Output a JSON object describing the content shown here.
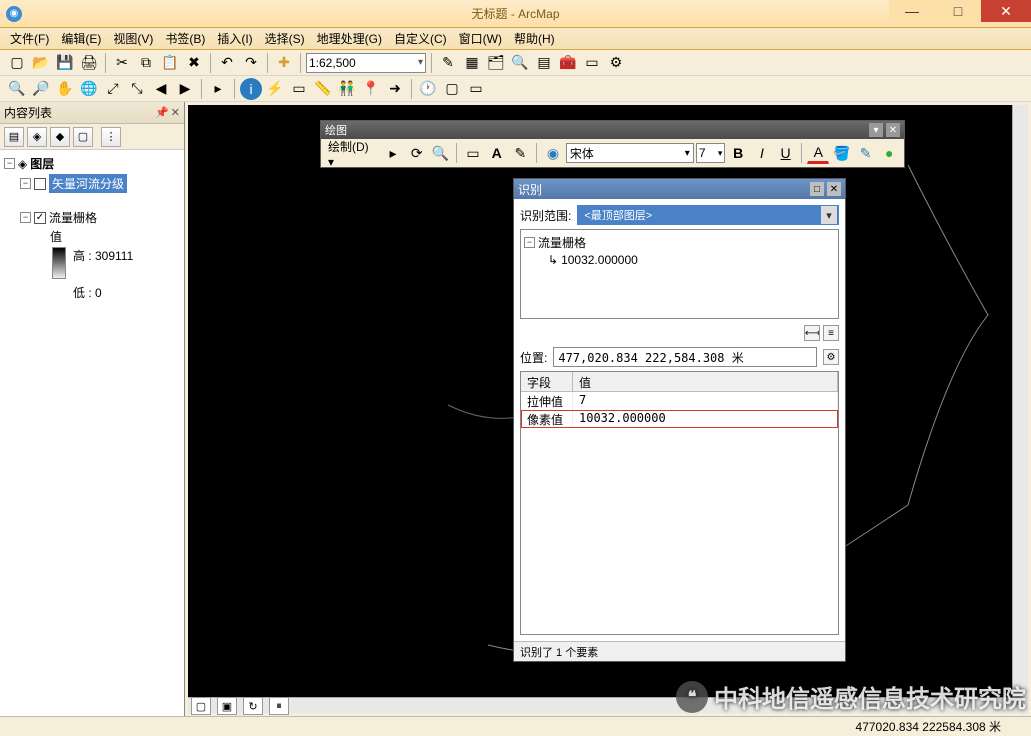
{
  "window": {
    "title": "无标题 - ArcMap",
    "min": "—",
    "max": "□",
    "close": "✕"
  },
  "menu": {
    "file": "文件(F)",
    "edit": "编辑(E)",
    "view": "视图(V)",
    "bookmarks": "书签(B)",
    "insert": "插入(I)",
    "selection": "选择(S)",
    "geoprocessing": "地理处理(G)",
    "customize": "自定义(C)",
    "windows": "窗口(W)",
    "help": "帮助(H)"
  },
  "toolbar1": {
    "scale": "1:62,500"
  },
  "toc": {
    "title": "内容列表",
    "root": "图层",
    "layer_vector": "矢量河流分级",
    "layer_raster": "流量栅格",
    "value_label": "值",
    "high_label": "高 : 309111",
    "low_label": "低 : 0"
  },
  "drawing": {
    "title": "绘图",
    "label": "绘制(D) ▾",
    "font": "宋体",
    "size": "7",
    "bold": "B",
    "italic": "I",
    "underline": "U",
    "fontcolor": "A"
  },
  "identify": {
    "title": "识别",
    "from_label": "识别范围:",
    "combo_value": "<最顶部图层>",
    "tree_node1": "流量栅格",
    "tree_node2": "10032.000000",
    "loc_label": "位置:",
    "loc_value": "477,020.834  222,584.308 米",
    "header_field": "字段",
    "header_value": "值",
    "row1_field": "拉伸值",
    "row1_value": "7",
    "row2_field": "像素值",
    "row2_value": "10032.000000",
    "status": "识别了 1 个要素"
  },
  "statusbar": {
    "coords": "477020.834 222584.308 米"
  },
  "watermark": {
    "text": "中科地信遥感信息技术研究院"
  }
}
